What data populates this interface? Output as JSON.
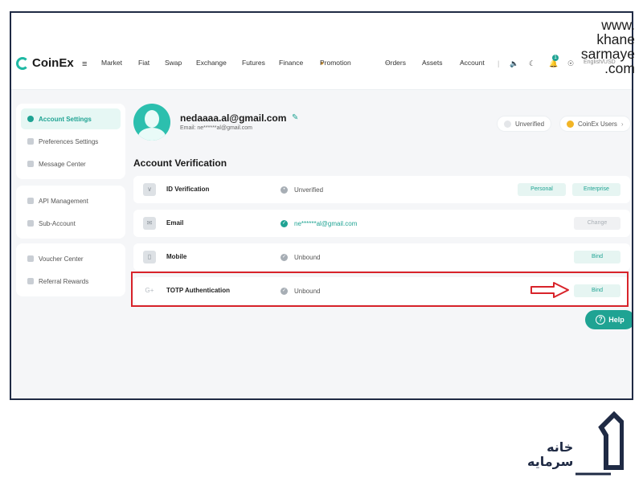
{
  "watermark": "www.\nkhane\nsarmaye\n.com",
  "header": {
    "logo_text": "CoinEx",
    "nav": [
      "Market",
      "Fiat",
      "Swap",
      "Exchange",
      "Futures",
      "Finance",
      "Promotion",
      "Orders",
      "Assets",
      "Account"
    ],
    "language": "English/USD",
    "notification_count": "1"
  },
  "sidebar": {
    "group1": [
      "Account Settings",
      "Preferences Settings",
      "Message Center"
    ],
    "group2": [
      "API Management",
      "Sub-Account"
    ],
    "group3": [
      "Voucher Center",
      "Referral Rewards"
    ]
  },
  "profile": {
    "email": "nedaaaa.al@gmail.com",
    "email_sub": "Email: ne******al@gmail.com",
    "verify_status": "Unverified",
    "user_type": "CoinEx Users"
  },
  "verification": {
    "title": "Account Verification",
    "rows": [
      {
        "name": "ID Verification",
        "status": "Unverified",
        "buttons": [
          "Personal",
          "Enterprise"
        ]
      },
      {
        "name": "Email",
        "status": "ne******al@gmail.com",
        "buttons": [
          "Change"
        ]
      },
      {
        "name": "Mobile",
        "status": "Unbound",
        "buttons": [
          "Bind"
        ]
      },
      {
        "name": "TOTP Authentication",
        "status": "Unbound",
        "buttons": [
          "Bind"
        ]
      }
    ]
  },
  "help_label": "Help",
  "brand_text": "خانه\nسرمایه",
  "colors": {
    "accent": "#1fa393",
    "highlight": "#d8232a",
    "frame": "#1f2a44"
  }
}
